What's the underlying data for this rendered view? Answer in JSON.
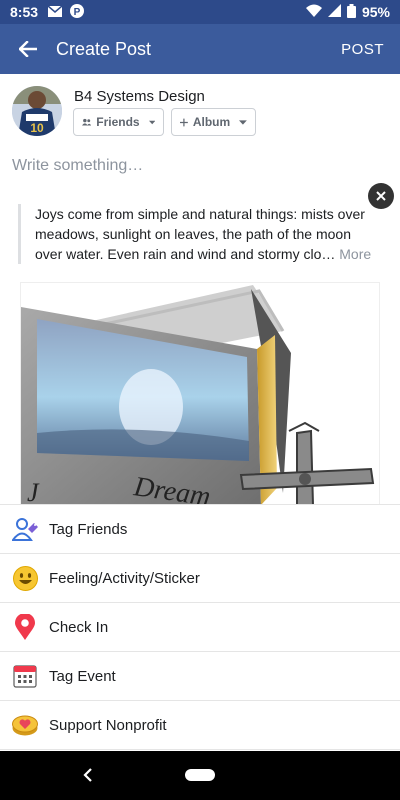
{
  "status_bar": {
    "time": "8:53",
    "battery": "95%",
    "icons": [
      "mail-icon",
      "p-app-icon",
      "wifi-icon",
      "signal-icon",
      "battery-icon"
    ]
  },
  "app_bar": {
    "title": "Create Post",
    "post_label": "POST",
    "color": "#3b5b9c"
  },
  "author": {
    "name": "B4 Systems Design",
    "audience_label": "Friends",
    "album_label": "Album"
  },
  "composer": {
    "placeholder": "Write something…"
  },
  "shared_text": {
    "body": "Joys come from simple and natural things: mists over meadows, sunlight on leaves, the path of the moon over water. Even rain and wind and stormy clo…",
    "more": "More"
  },
  "actions": [
    {
      "label": "Tag Friends",
      "icon": "tag-friends-icon"
    },
    {
      "label": "Feeling/Activity/Sticker",
      "icon": "smiley-icon"
    },
    {
      "label": "Check In",
      "icon": "location-pin-icon"
    },
    {
      "label": "Tag Event",
      "icon": "calendar-icon"
    },
    {
      "label": "Support Nonprofit",
      "icon": "heart-coin-icon"
    }
  ]
}
